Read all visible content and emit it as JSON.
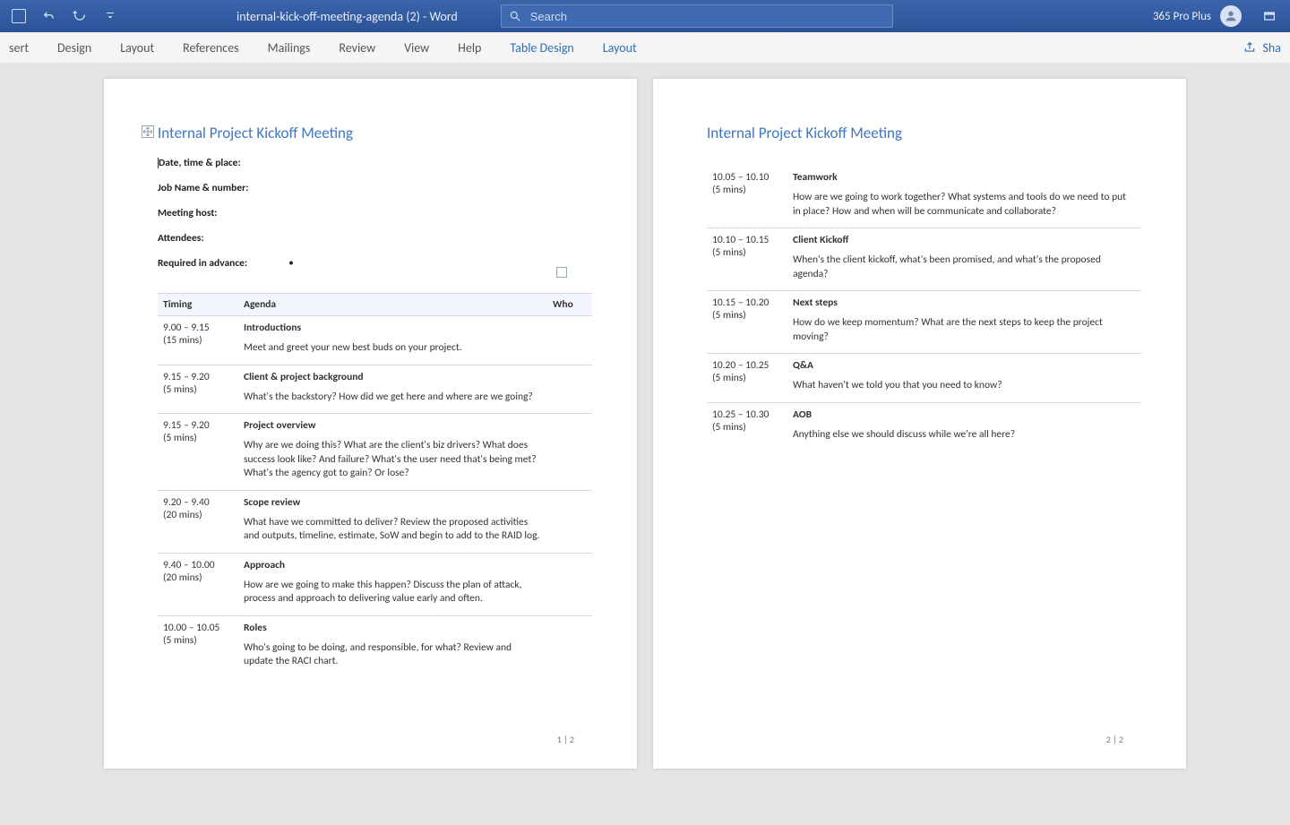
{
  "window": {
    "doc_title": "internal-kick-off-meeting-agenda (2)  -  Word",
    "search_placeholder": "Search",
    "plan_label": "365 Pro Plus"
  },
  "ribbon": {
    "tabs": [
      "sert",
      "Design",
      "Layout",
      "References",
      "Mailings",
      "Review",
      "View",
      "Help"
    ],
    "context_tabs": [
      "Table Design",
      "Layout"
    ],
    "share_label": "Sha"
  },
  "document": {
    "title": "Internal Project Kickoff Meeting",
    "meta": {
      "date": "Date, time & place:",
      "job": "Job Name & number:",
      "host": "Meeting host:",
      "attendees": "Attendees:",
      "required": "Required in advance:"
    },
    "columns": {
      "timing": "Timing",
      "agenda": "Agenda",
      "who": "Who"
    },
    "page1_footer": "1 | 2",
    "page2_footer": "2 | 2",
    "items_p1": [
      {
        "time": "9.00 – 9.15",
        "dur": "(15 mins)",
        "title": "Introductions",
        "desc": "Meet and greet your new best buds on your project."
      },
      {
        "time": "9.15 – 9.20",
        "dur": "(5 mins)",
        "title": "Client & project background",
        "desc": "What's the backstory? How did we get here and where are we going?"
      },
      {
        "time": "9.15 – 9.20",
        "dur": "(5 mins)",
        "title": "Project overview",
        "desc": "Why are we doing this? What are the client's biz drivers? What does success look like? And failure? What's the user need that's being met? What's the agency got to gain? Or lose?"
      },
      {
        "time": "9.20 – 9.40",
        "dur": "(20 mins)",
        "title": "Scope review",
        "desc": "What have we committed to deliver? Review the proposed activities and outputs, timeline, estimate, SoW and begin to add to the RAID log."
      },
      {
        "time": "9.40 – 10.00",
        "dur": "(20 mins)",
        "title": "Approach",
        "desc": "How are we going to make this happen? Discuss the plan of attack, process and approach to delivering value early and often."
      },
      {
        "time": "10.00 – 10.05",
        "dur": "(5 mins)",
        "title": "Roles",
        "desc": "Who's going to be doing, and responsible, for what? Review and update the RACI chart."
      }
    ],
    "items_p2": [
      {
        "time": "10.05 – 10.10",
        "dur": "(5 mins)",
        "title": "Teamwork",
        "desc": "How are we going to work together? What systems and tools do we need to put in place? How and when will be communicate and collaborate?"
      },
      {
        "time": "10.10 – 10.15",
        "dur": "(5 mins)",
        "title": "Client Kickoff",
        "desc": "When's the client kickoff, what's been promised, and what's the proposed agenda?"
      },
      {
        "time": "10.15 – 10.20",
        "dur": "(5 mins)",
        "title": "Next steps",
        "desc": "How do we keep momentum? What are the next steps to keep the project moving?"
      },
      {
        "time": "10.20 – 10.25",
        "dur": "(5 mins)",
        "title": "Q&A",
        "desc": "What haven't we told you that you need to know?"
      },
      {
        "time": "10.25 – 10.30",
        "dur": "(5 mins)",
        "title": "AOB",
        "desc": "Anything else we should discuss while we're all here?"
      }
    ]
  }
}
